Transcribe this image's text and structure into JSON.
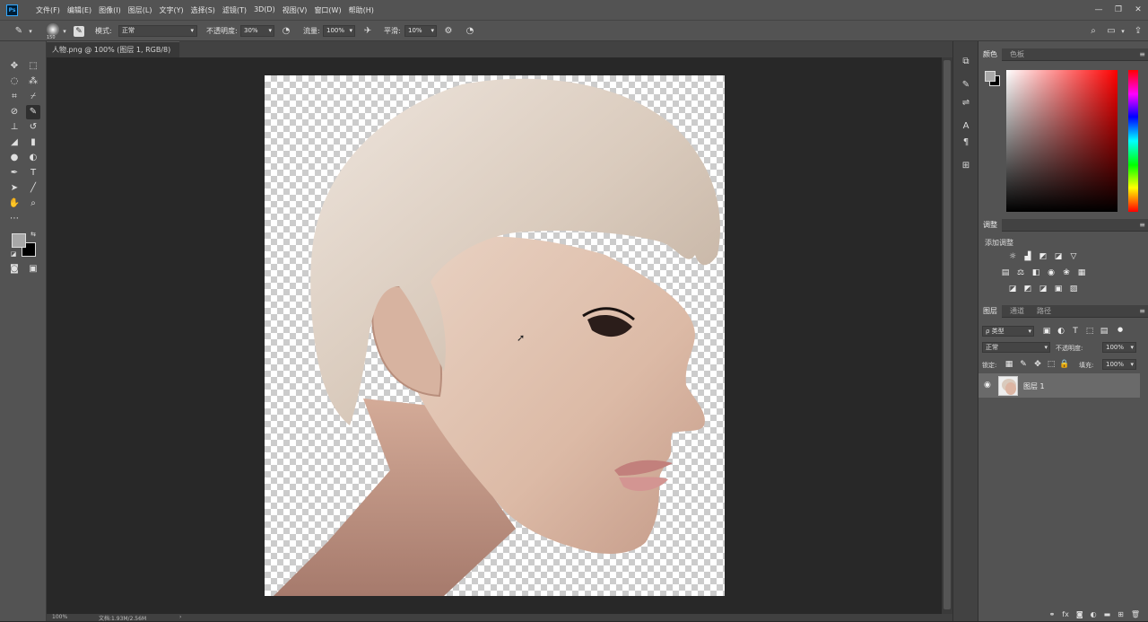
{
  "menubar": {
    "logo": "Ps",
    "items": [
      "文件(F)",
      "编辑(E)",
      "图像(I)",
      "图层(L)",
      "文字(Y)",
      "选择(S)",
      "滤镜(T)",
      "3D(D)",
      "视图(V)",
      "窗口(W)",
      "帮助(H)"
    ],
    "window_controls": [
      "—",
      "❐",
      "✕"
    ]
  },
  "options": {
    "brush_size": "150",
    "mode_label": "模式:",
    "mode_value": "正常",
    "opacity_label": "不透明度:",
    "opacity_value": "30%",
    "flow_label": "流量:",
    "flow_value": "100%",
    "smooth_label": "平滑:",
    "smooth_value": "10%"
  },
  "document": {
    "tab_title": "人物.png @ 100% (图层 1, RGB/8)",
    "tab_close": "×",
    "zoom": "100%",
    "doc_info": "文档:1.93M/2.56M",
    "status_arrow": "›"
  },
  "panels": {
    "color": {
      "tabs": [
        "颜色",
        "色板"
      ],
      "foreground": "#a8a8a8",
      "background": "#000000"
    },
    "adjust": {
      "tabs": [
        "调整"
      ],
      "label": "添加调整"
    },
    "layers": {
      "tabs": [
        "图层",
        "通道",
        "路径"
      ],
      "filter_label": "ρ 类型",
      "blend_mode": "正常",
      "opacity_label": "不透明度:",
      "opacity_value": "100%",
      "lock_label": "锁定:",
      "fill_label": "填充:",
      "fill_value": "100%",
      "layer_name": "图层 1"
    }
  },
  "colors": {
    "accent": "#31a8ff",
    "panel_bg": "#535353",
    "canvas_bg": "#282828"
  }
}
